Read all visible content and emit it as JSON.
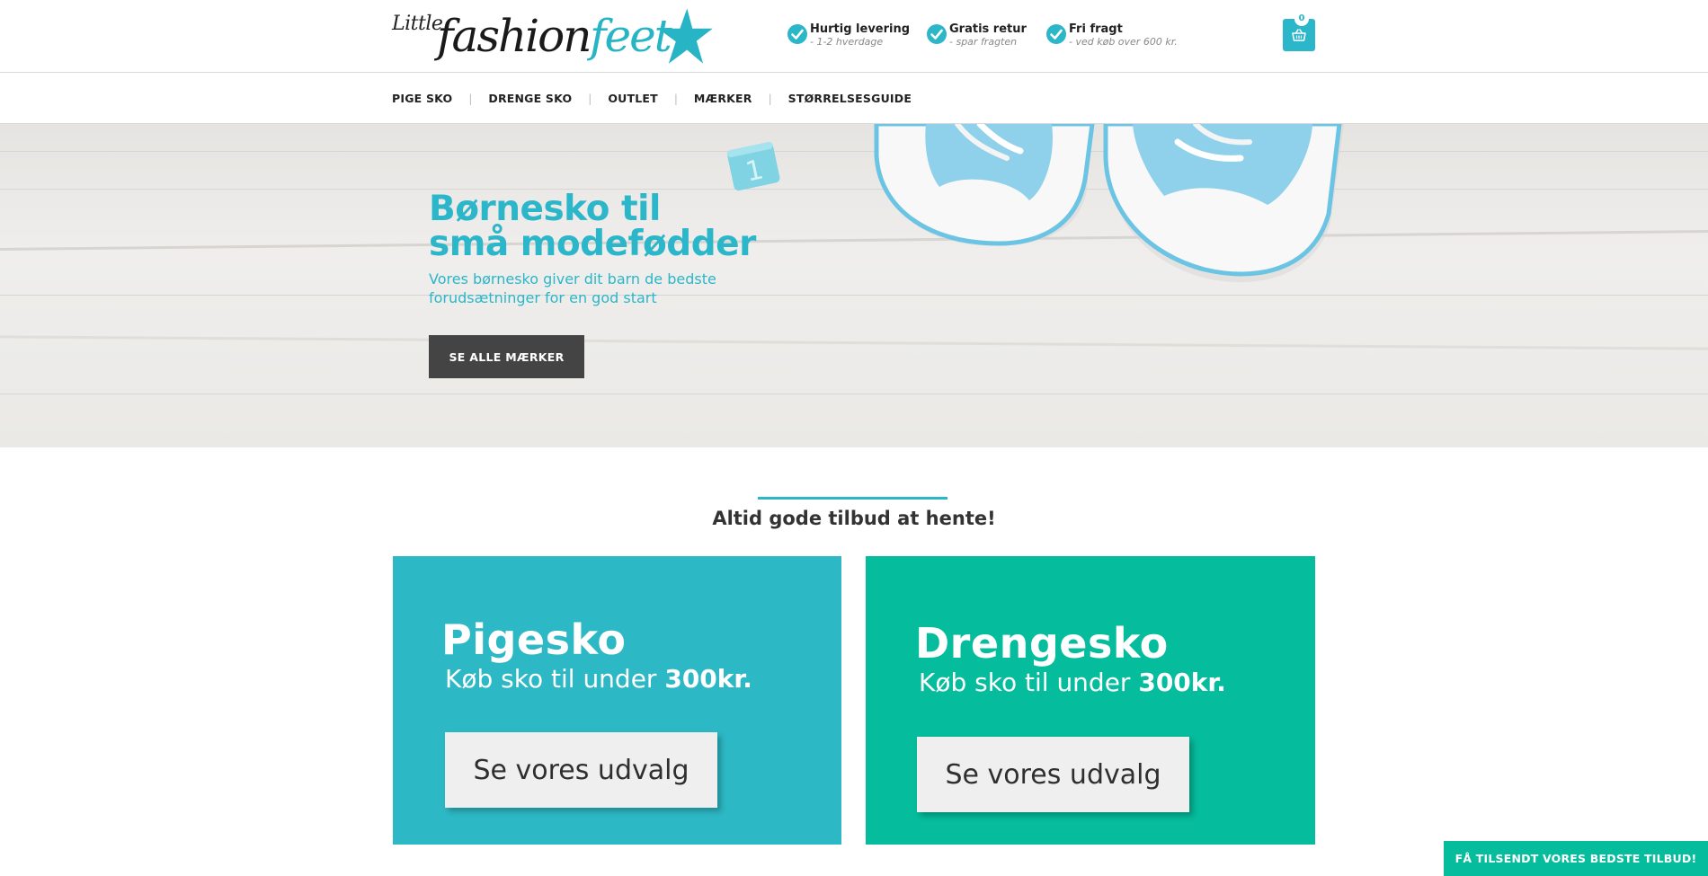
{
  "logo": {
    "little": "Little",
    "fashion": "fashion",
    "feet": "feet"
  },
  "usps": [
    {
      "title": "Hurtig levering",
      "sub": "- 1-2 hverdage"
    },
    {
      "title": "Gratis retur",
      "sub": "- spar fragten"
    },
    {
      "title": "Fri fragt",
      "sub": "- ved køb over 600 kr."
    }
  ],
  "cart": {
    "count": "0",
    "icon": "basket-icon"
  },
  "nav": {
    "items": [
      "PIGE SKO",
      "DRENGE SKO",
      "OUTLET",
      "MÆRKER",
      "STØRRELSESGUIDE"
    ],
    "separator": "|"
  },
  "hero": {
    "title_line1": "Børnesko til",
    "title_line2": "små modefødder",
    "subtitle": "Vores børnesko giver dit barn de bedste forudsætninger for en god start",
    "button": "SE ALLE MÆRKER",
    "block_number": "1"
  },
  "offers": {
    "heading": "Altid gode tilbud at hente!",
    "cards": [
      {
        "title": "Pigesko",
        "sub_prefix": "Køb sko til under ",
        "sub_price": "300kr.",
        "button": "Se vores udvalg",
        "color": "#2db8c5"
      },
      {
        "title": "Drengesko",
        "sub_prefix": "Køb sko til under ",
        "sub_price": "300kr.",
        "button": "Se vores udvalg",
        "color": "#05bc9c"
      }
    ]
  },
  "newsletter": {
    "label": "FÅ TILSENDT VORES BEDSTE TILBUD!"
  },
  "colors": {
    "accent": "#2cb6c9",
    "green": "#05bc9c",
    "dark_button": "#444444"
  }
}
